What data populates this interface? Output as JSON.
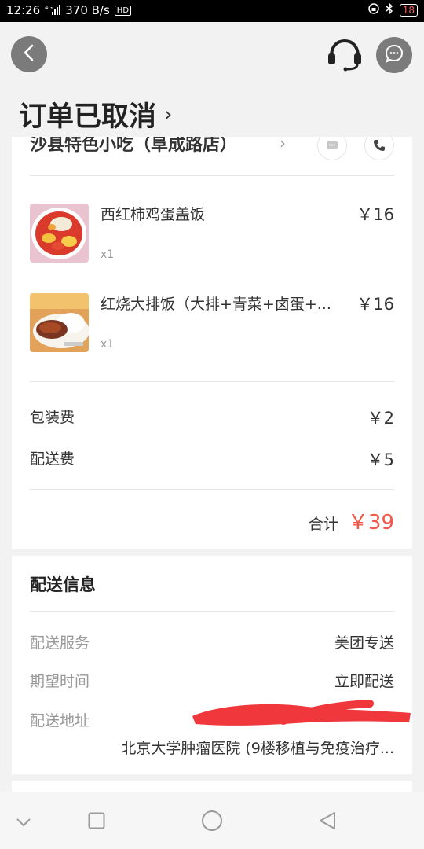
{
  "status_bar": {
    "time": "12:26",
    "network": "4G",
    "speed": "370 B/s",
    "hd": "HD",
    "battery": "18"
  },
  "header": {
    "title": "订单已取消",
    "chevron": "›"
  },
  "store": {
    "name": "沙县特色小吃（阜成路店）",
    "chevron": "›"
  },
  "items": [
    {
      "name": "西红柿鸡蛋盖饭",
      "qty": "x1",
      "price": "￥16"
    },
    {
      "name": "红烧大排饭（大排+青菜+卤蛋+...",
      "qty": "x1",
      "price": "￥16"
    }
  ],
  "fees": [
    {
      "label": "包装费",
      "value": "￥2"
    },
    {
      "label": "配送费",
      "value": "￥5"
    }
  ],
  "total": {
    "label": "合计",
    "value": "￥39"
  },
  "delivery": {
    "title": "配送信息",
    "rows": [
      {
        "key": "配送服务",
        "value": "美团专送"
      },
      {
        "key": "期望时间",
        "value": "立即配送"
      },
      {
        "key": "配送地址",
        "value": ""
      }
    ],
    "address": "北京大学肿瘤医院 (9楼移植与免疫治疗..."
  },
  "colors": {
    "accent_red": "#f2584a",
    "redaction": "#f0383c"
  },
  "icons": {
    "back": "chevron-left-icon",
    "customer_service": "headset-icon",
    "chat": "chat-bubble-icon"
  }
}
